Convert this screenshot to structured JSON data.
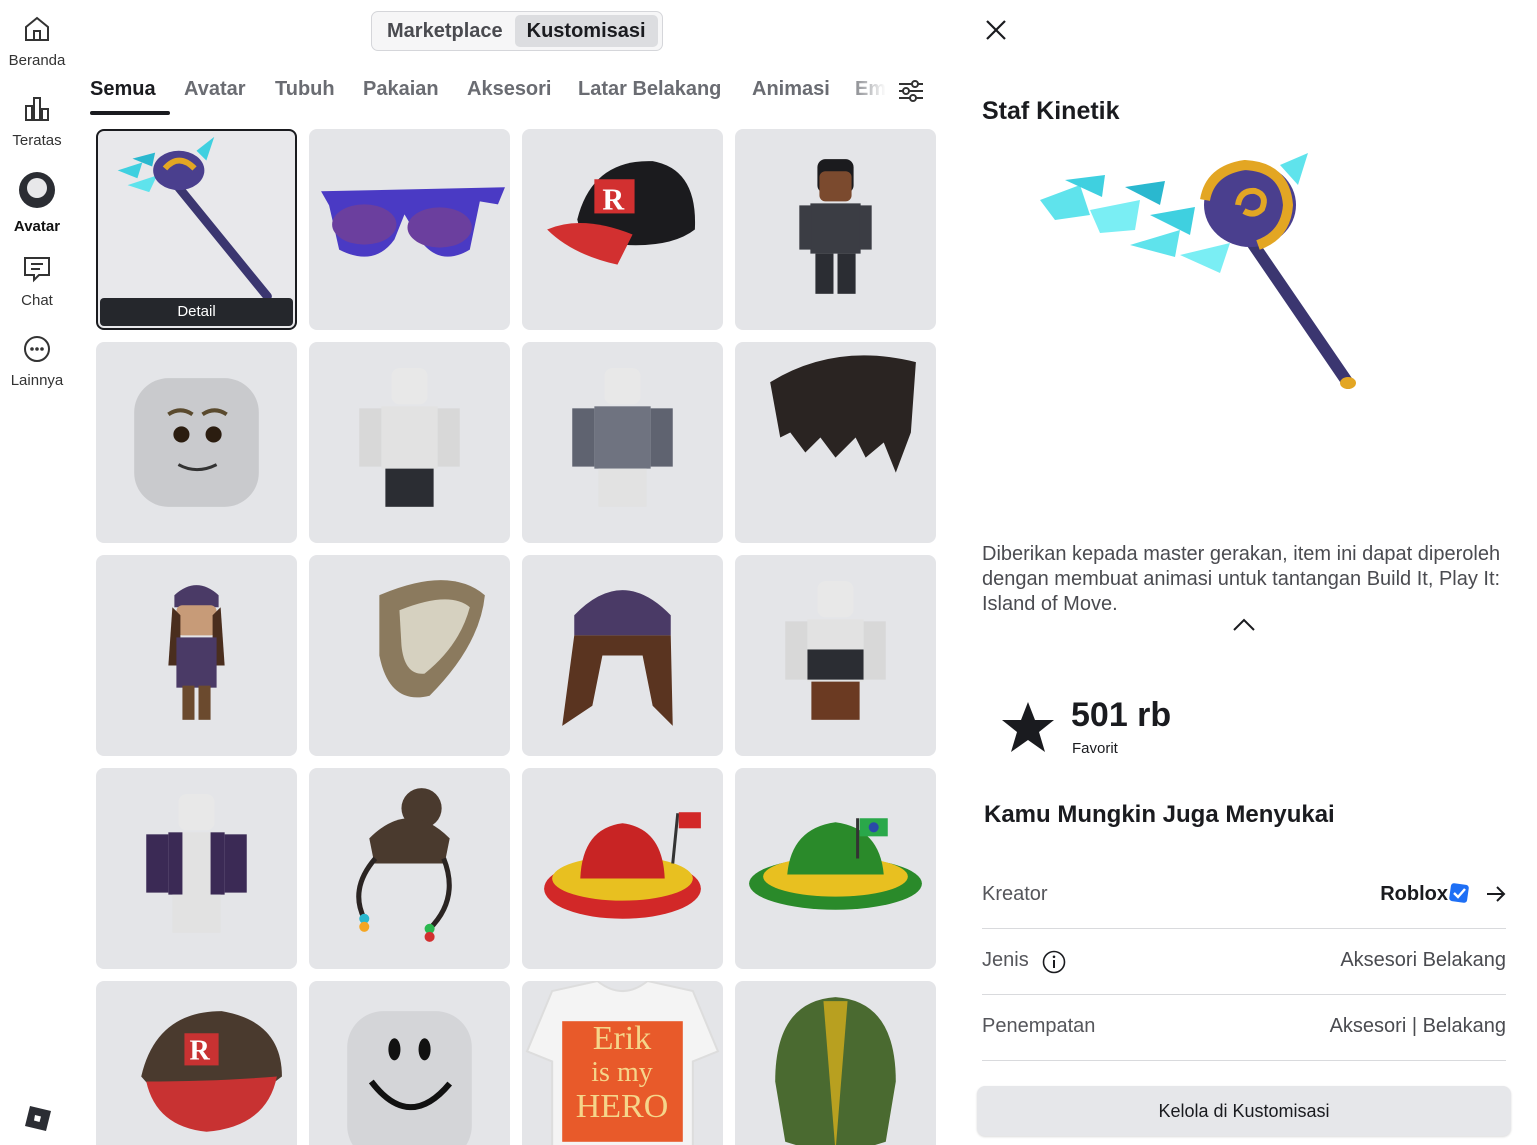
{
  "nav": {
    "items": [
      {
        "label": "Beranda",
        "icon": "home-icon"
      },
      {
        "label": "Teratas",
        "icon": "chart-icon"
      },
      {
        "label": "Avatar",
        "icon": "avatar-icon"
      },
      {
        "label": "Chat",
        "icon": "chat-icon"
      },
      {
        "label": "Lainnya",
        "icon": "more-icon"
      }
    ],
    "active": "Avatar"
  },
  "segment": {
    "options": [
      "Marketplace",
      "Kustomisasi"
    ],
    "selected": "Kustomisasi"
  },
  "tabs": {
    "items": [
      "Semua",
      "Avatar",
      "Tubuh",
      "Pakaian",
      "Aksesori",
      "Latar Belakang",
      "Animasi",
      "Em"
    ],
    "active": "Semua"
  },
  "grid": {
    "selected_detail_label": "Detail",
    "items": [
      {
        "icon": "kinetic-staff"
      },
      {
        "icon": "purple-sunglasses"
      },
      {
        "icon": "red-r-cap"
      },
      {
        "icon": "avatar-boy"
      },
      {
        "icon": "face-eyebrows"
      },
      {
        "icon": "white-shirt-body"
      },
      {
        "icon": "grey-shirt-body"
      },
      {
        "icon": "black-hair"
      },
      {
        "icon": "avatar-girl-beanie"
      },
      {
        "icon": "scarf"
      },
      {
        "icon": "beanie-hair"
      },
      {
        "icon": "striped-shirt-body"
      },
      {
        "icon": "purple-jacket-body"
      },
      {
        "icon": "bun-hair-beads"
      },
      {
        "icon": "vietnam-hat"
      },
      {
        "icon": "brazil-hat"
      },
      {
        "icon": "brown-r-cap"
      },
      {
        "icon": "smile-face"
      },
      {
        "icon": "erik-tshirt"
      },
      {
        "icon": "green-hood"
      }
    ],
    "tshirt_text": [
      "Erik",
      "is my",
      "HERO"
    ]
  },
  "detail": {
    "title": "Staf Kinetik",
    "description": "Diberikan kepada master gerakan, item ini dapat diperoleh dengan membuat animasi untuk tantangan Build It, Play It: Island of Move.",
    "favorites_count": "501 rb",
    "favorites_label": "Favorit",
    "recommend_heading": "Kamu Mungkin Juga Menyukai",
    "rows": {
      "creator_label": "Kreator",
      "creator_value": "Roblox",
      "type_label": "Jenis",
      "type_value": "Aksesori Belakang",
      "placement_label": "Penempatan",
      "placement_value": "Aksesori | Belakang"
    },
    "manage_button": "Kelola di Kustomisasi"
  },
  "colors": {
    "accent_verified": "#1e6ff5",
    "tile_bg": "#e4e5e8",
    "text_primary": "#1a1b1f"
  }
}
